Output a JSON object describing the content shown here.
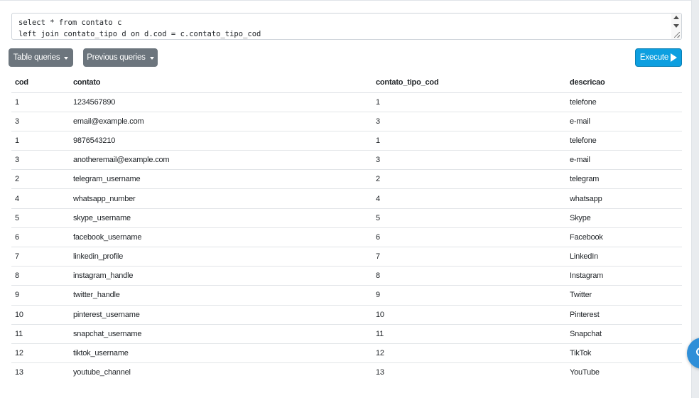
{
  "editor": {
    "lines": [
      "select * from contato c",
      "left join contato_tipo d on d.cod = c.contato_tipo_cod"
    ]
  },
  "toolbar": {
    "table_queries_label": "Table queries",
    "previous_queries_label": "Previous queries",
    "execute_label": "Execute"
  },
  "table": {
    "columns": [
      "cod",
      "contato",
      "contato_tipo_cod",
      "descricao"
    ],
    "rows": [
      [
        "1",
        "1234567890",
        "1",
        "telefone"
      ],
      [
        "3",
        "email@example.com",
        "3",
        "e-mail"
      ],
      [
        "1",
        "9876543210",
        "1",
        "telefone"
      ],
      [
        "3",
        "anotheremail@example.com",
        "3",
        "e-mail"
      ],
      [
        "2",
        "telegram_username",
        "2",
        "telegram"
      ],
      [
        "4",
        "whatsapp_number",
        "4",
        "whatsapp"
      ],
      [
        "5",
        "skype_username",
        "5",
        "Skype"
      ],
      [
        "6",
        "facebook_username",
        "6",
        "Facebook"
      ],
      [
        "7",
        "linkedin_profile",
        "7",
        "LinkedIn"
      ],
      [
        "8",
        "instagram_handle",
        "8",
        "Instagram"
      ],
      [
        "9",
        "twitter_handle",
        "9",
        "Twitter"
      ],
      [
        "10",
        "pinterest_username",
        "10",
        "Pinterest"
      ],
      [
        "11",
        "snapchat_username",
        "11",
        "Snapchat"
      ],
      [
        "12",
        "tiktok_username",
        "12",
        "TikTok"
      ],
      [
        "13",
        "youtube_channel",
        "13",
        "YouTube"
      ]
    ]
  },
  "colors": {
    "secondary_button": "#6c757d",
    "primary_button": "#0d9fe0",
    "floating_button": "#2f8fd8"
  },
  "icons": {
    "table_queries": "caret-down-icon",
    "previous_queries": "caret-down-icon",
    "execute": "play-icon",
    "floating": "chat-icon"
  }
}
